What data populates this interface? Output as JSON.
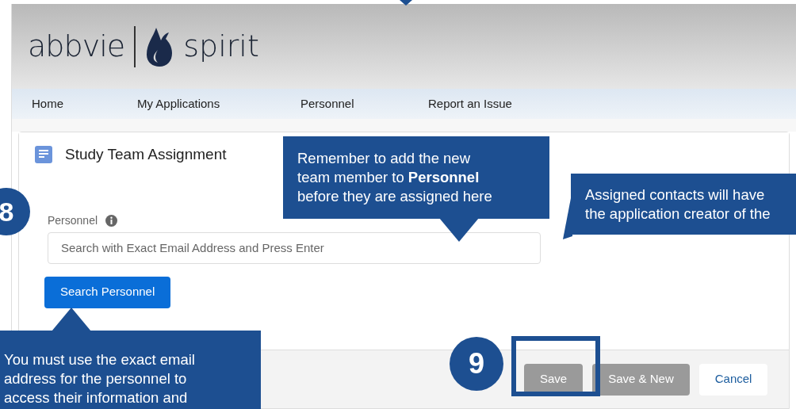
{
  "header": {
    "brand": "abbvie",
    "product": "spirit"
  },
  "nav": [
    {
      "label": "Home"
    },
    {
      "label": "My Applications"
    },
    {
      "label": "Personnel"
    },
    {
      "label": "Report an Issue"
    }
  ],
  "card": {
    "title": "Study Team Assignment",
    "field": {
      "label": "Personnel",
      "placeholder": "Search with Exact Email Address and Press Enter"
    },
    "search_button": "Search Personnel"
  },
  "footer_buttons": [
    {
      "label": "Save",
      "disabled": true
    },
    {
      "label": "Save & New",
      "disabled": true
    },
    {
      "label": "Cancel",
      "disabled": false
    }
  ],
  "callouts": [
    {
      "lines": [
        "Remember to add the new",
        "team member  to **Personnel**",
        "before they are assigned here"
      ]
    },
    {
      "lines": [
        "Assigned contacts will have",
        "the application creator of the"
      ]
    },
    {
      "lines": [
        "You must use the exact email",
        "address for the personnel to",
        "access their information and"
      ]
    }
  ],
  "steps": [
    "8",
    "9"
  ]
}
